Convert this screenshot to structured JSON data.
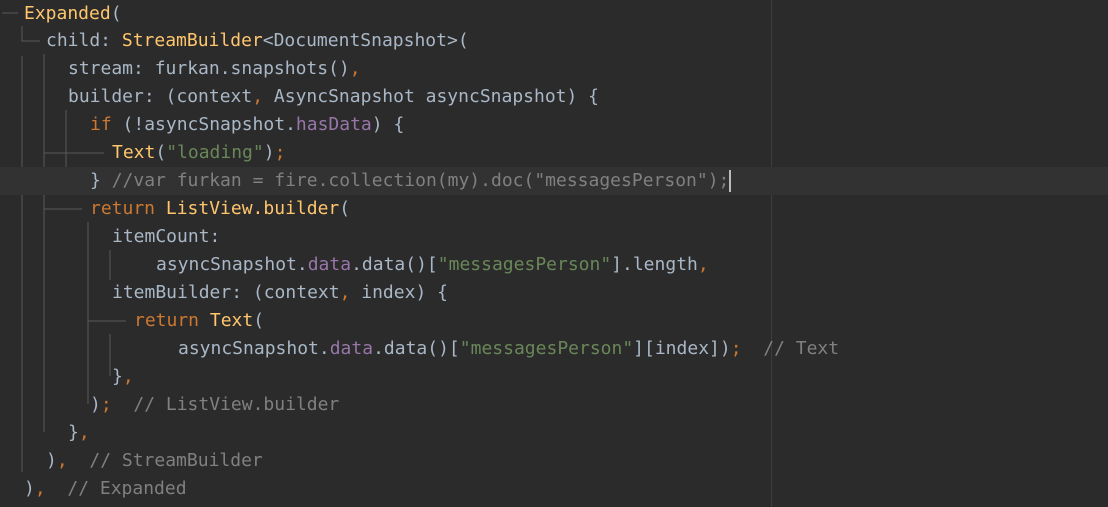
{
  "editor": {
    "language": "dart",
    "colors": {
      "background": "#2b2b2b",
      "current_line": "#323232",
      "text": "#a9b7c6",
      "keyword": "#cc7832",
      "class_name": "#ffc66d",
      "string": "#6a8759",
      "field": "#9876aa",
      "comment": "#808080",
      "caret": "#bbbbbb"
    },
    "lines": [
      {
        "tokens": [
          {
            "t": "Expanded",
            "c": "cls"
          },
          {
            "t": "(",
            "c": "plain"
          }
        ]
      },
      {
        "tokens": [
          {
            "t": "child: ",
            "c": "plain"
          },
          {
            "t": "StreamBuilder",
            "c": "cls"
          },
          {
            "t": "<DocumentSnapshot>(",
            "c": "plain"
          }
        ]
      },
      {
        "tokens": [
          {
            "t": "stream: furkan.snapshots()",
            "c": "plain"
          },
          {
            "t": ",",
            "c": "kw"
          }
        ]
      },
      {
        "tokens": [
          {
            "t": "builder: (context",
            "c": "plain"
          },
          {
            "t": ",",
            "c": "kw"
          },
          {
            "t": " AsyncSnapshot asyncSnapshot) {",
            "c": "plain"
          }
        ]
      },
      {
        "tokens": [
          {
            "t": "if ",
            "c": "kw"
          },
          {
            "t": "(!asyncSnapshot.",
            "c": "plain"
          },
          {
            "t": "hasData",
            "c": "fld"
          },
          {
            "t": ") {",
            "c": "plain"
          }
        ]
      },
      {
        "tokens": [
          {
            "t": "Text",
            "c": "cls"
          },
          {
            "t": "(",
            "c": "plain"
          },
          {
            "t": "\"loading\"",
            "c": "str"
          },
          {
            "t": ")",
            "c": "plain"
          },
          {
            "t": ";",
            "c": "kw"
          }
        ]
      },
      {
        "tokens": [
          {
            "t": "} ",
            "c": "plain"
          },
          {
            "t": "//var furkan = fire.collection(my).doc(\"messagesPerson\");",
            "c": "cmt"
          }
        ],
        "caret": true
      },
      {
        "tokens": [
          {
            "t": "return ",
            "c": "kw"
          },
          {
            "t": "ListView.builder",
            "c": "cls"
          },
          {
            "t": "(",
            "c": "plain"
          }
        ]
      },
      {
        "tokens": [
          {
            "t": "itemCount:",
            "c": "plain"
          }
        ]
      },
      {
        "tokens": [
          {
            "t": "asyncSnapshot.",
            "c": "plain"
          },
          {
            "t": "data",
            "c": "fld"
          },
          {
            "t": ".data()[",
            "c": "plain"
          },
          {
            "t": "\"messagesPerson\"",
            "c": "str"
          },
          {
            "t": "].length",
            "c": "plain"
          },
          {
            "t": ",",
            "c": "kw"
          }
        ]
      },
      {
        "tokens": [
          {
            "t": "itemBuilder: (context",
            "c": "plain"
          },
          {
            "t": ",",
            "c": "kw"
          },
          {
            "t": " index) {",
            "c": "plain"
          }
        ]
      },
      {
        "tokens": [
          {
            "t": "return ",
            "c": "kw"
          },
          {
            "t": "Text",
            "c": "cls"
          },
          {
            "t": "(",
            "c": "plain"
          }
        ]
      },
      {
        "tokens": [
          {
            "t": "asyncSnapshot.",
            "c": "plain"
          },
          {
            "t": "data",
            "c": "fld"
          },
          {
            "t": ".data()[",
            "c": "plain"
          },
          {
            "t": "\"messagesPerson\"",
            "c": "str"
          },
          {
            "t": "][index])",
            "c": "plain"
          },
          {
            "t": ";",
            "c": "kw"
          },
          {
            "t": "  // Text",
            "c": "cmt"
          }
        ]
      },
      {
        "tokens": [
          {
            "t": "}",
            "c": "plain"
          },
          {
            "t": ",",
            "c": "kw"
          }
        ]
      },
      {
        "tokens": [
          {
            "t": ")",
            "c": "plain"
          },
          {
            "t": ";",
            "c": "kw"
          },
          {
            "t": "  // ListView.builder",
            "c": "cmt"
          }
        ]
      },
      {
        "tokens": [
          {
            "t": "}",
            "c": "plain"
          },
          {
            "t": ",",
            "c": "kw"
          }
        ]
      },
      {
        "tokens": [
          {
            "t": ")",
            "c": "plain"
          },
          {
            "t": ",",
            "c": "kw"
          },
          {
            "t": "  // StreamBuilder",
            "c": "cmt"
          }
        ]
      },
      {
        "tokens": [
          {
            "t": ")",
            "c": "plain"
          },
          {
            "t": ",",
            "c": "kw"
          },
          {
            "t": "  // Expanded",
            "c": "cmt"
          }
        ]
      }
    ]
  }
}
